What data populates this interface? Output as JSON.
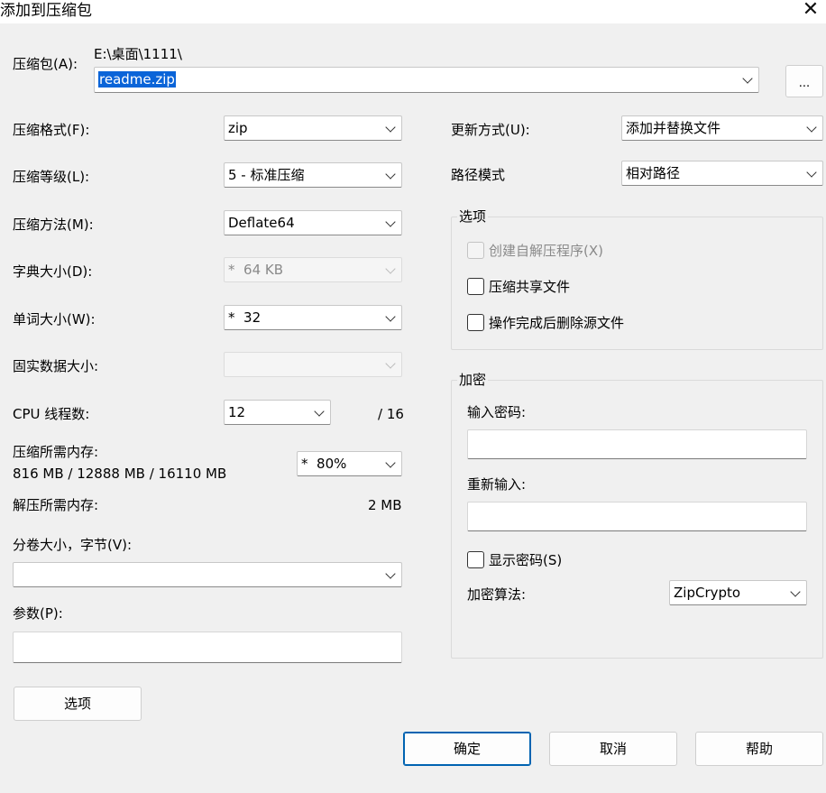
{
  "window": {
    "title": "添加到压缩包",
    "close_glyph": "✕"
  },
  "archive": {
    "label": "压缩包(A):",
    "path": "E:\\桌面\\1111\\",
    "filename": "readme.zip",
    "browse_label": "..."
  },
  "left": {
    "format": {
      "label": "压缩格式(F):",
      "value": "zip"
    },
    "level": {
      "label": "压缩等级(L):",
      "value": "5 - 标准压缩"
    },
    "method": {
      "label": "压缩方法(M):",
      "value": "Deflate64"
    },
    "dict": {
      "label": "字典大小(D):",
      "value": "*  64 KB"
    },
    "word": {
      "label": "单词大小(W):",
      "value": "*  32"
    },
    "solid": {
      "label": "固实数据大小:",
      "value": ""
    },
    "threads": {
      "label": "CPU 线程数:",
      "value": "12",
      "max": "/ 16"
    },
    "mem_compress": {
      "label": "压缩所需内存:",
      "detail": "816 MB / 12888 MB / 16110 MB",
      "value": "*  80%"
    },
    "mem_decompress": {
      "label": "解压所需内存:",
      "value": "2 MB"
    },
    "split": {
      "label": "分卷大小，字节(V):",
      "value": ""
    },
    "params": {
      "label": "参数(P):",
      "value": ""
    },
    "options_button": "选项"
  },
  "right": {
    "update": {
      "label": "更新方式(U):",
      "value": "添加并替换文件"
    },
    "path_mode": {
      "label": "路径模式",
      "value": "相对路径"
    },
    "options_group": {
      "title": "选项",
      "sfx": {
        "label": "创建自解压程序(X)",
        "checked": false,
        "disabled": true
      },
      "shared": {
        "label": "压缩共享文件",
        "checked": false
      },
      "delete": {
        "label": "操作完成后删除源文件",
        "checked": false
      }
    },
    "encryption": {
      "title": "加密",
      "password_label": "输入密码:",
      "reenter_label": "重新输入:",
      "show_password": {
        "label": "显示密码(S)",
        "checked": false
      },
      "method_label": "加密算法:",
      "method_value": "ZipCrypto"
    }
  },
  "buttons": {
    "ok": "确定",
    "cancel": "取消",
    "help": "帮助"
  },
  "colors": {
    "selection": "#0a64d8",
    "primary_border": "#0063b1",
    "background": "#f0f0f0"
  }
}
